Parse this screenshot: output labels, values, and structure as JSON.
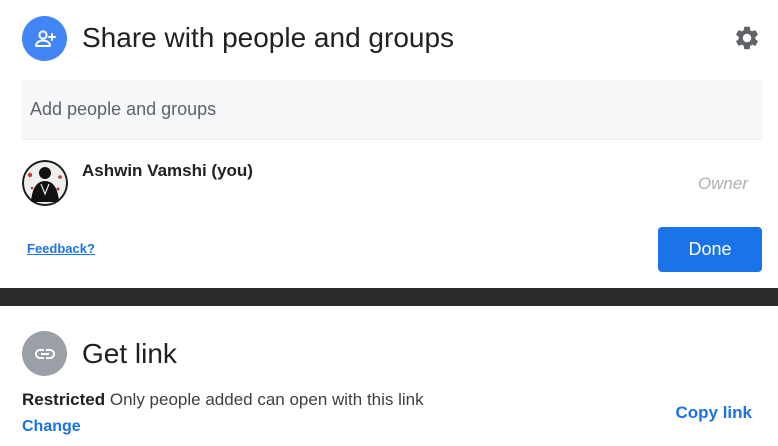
{
  "share_dialog": {
    "title": "Share with people and groups",
    "icon": "person-add-icon",
    "settings_icon": "gear-icon",
    "input_placeholder": "Add people and groups",
    "people": [
      {
        "name": "Ashwin Vamshi (you)",
        "role": "Owner"
      }
    ],
    "feedback_label": "Feedback?",
    "done_label": "Done"
  },
  "link_section": {
    "title": "Get link",
    "icon": "link-icon",
    "restriction_label": "Restricted",
    "restriction_description": "Only people added can open with this link",
    "change_label": "Change",
    "copy_label": "Copy link"
  },
  "colors": {
    "accent": "#1a73e8",
    "share_icon_bg": "#4285f4",
    "link_icon_bg": "#9aa0a6",
    "divider": "#2b2b2b"
  }
}
